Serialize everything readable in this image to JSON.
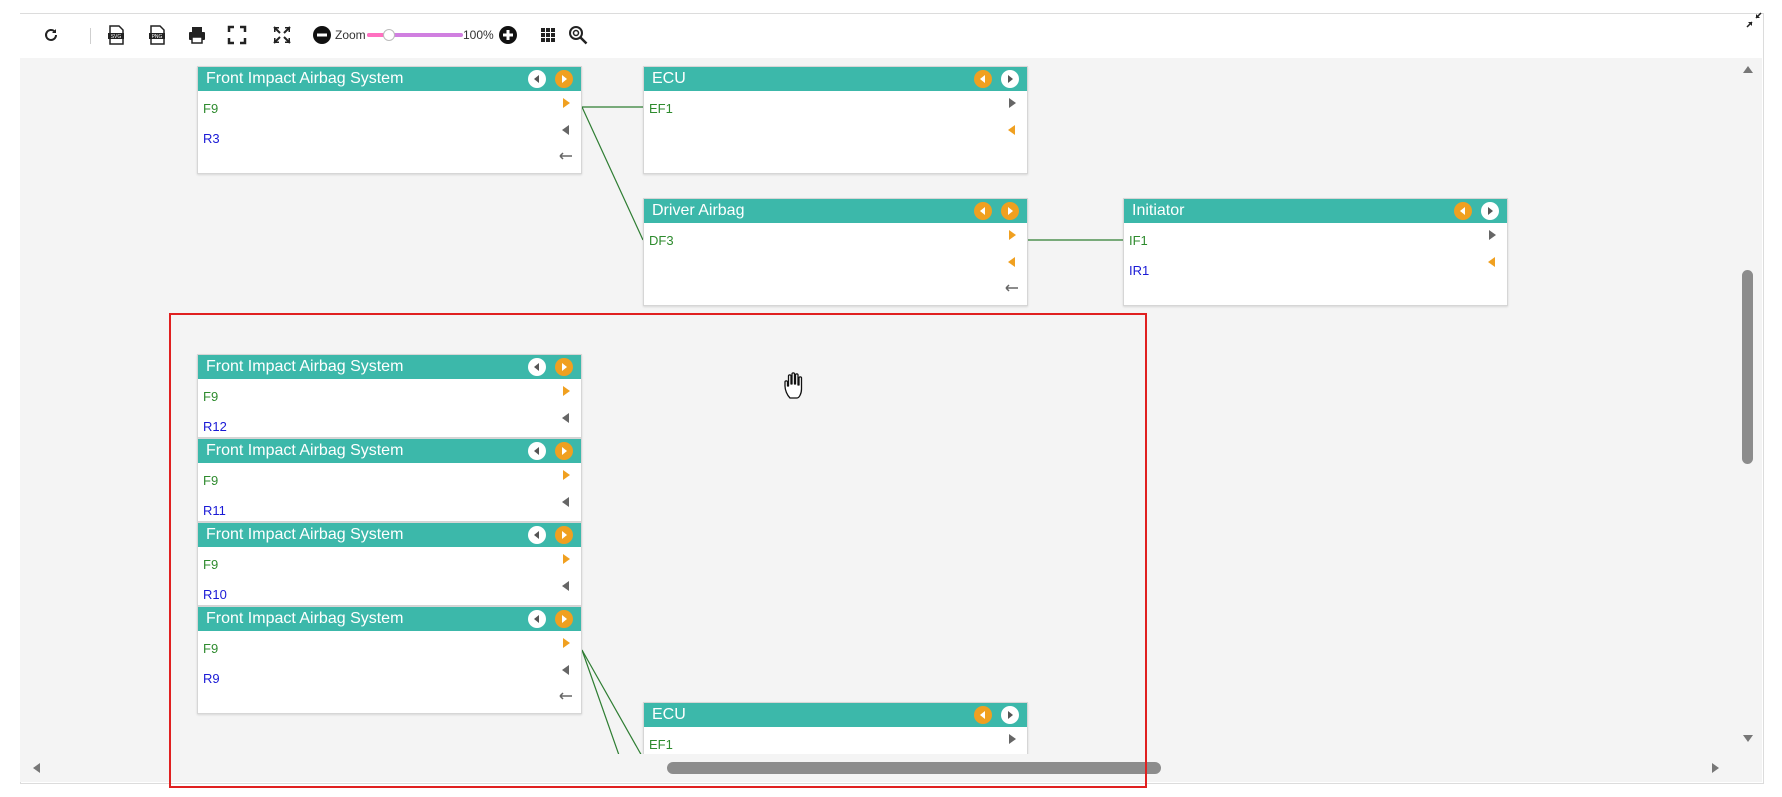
{
  "toolbar": {
    "buttons": [
      {
        "name": "refresh-icon"
      },
      {
        "name": "export-svg-icon",
        "label": "SVG"
      },
      {
        "name": "export-png-icon",
        "label": "PNG"
      },
      {
        "name": "print-icon"
      },
      {
        "name": "fullscreen-icon"
      },
      {
        "name": "fit-to-screen-icon"
      },
      {
        "name": "zoom-out-icon"
      }
    ],
    "zoom_label": "Zoom",
    "zoom_value": "100%",
    "zoom_fraction": 0.2,
    "after_zoom": [
      {
        "name": "zoom-in-icon"
      },
      {
        "name": "grid-icon"
      },
      {
        "name": "search-settings-icon"
      }
    ]
  },
  "colors": {
    "node_header": "#3cb8aa",
    "input_port_text": "#2e8b2e",
    "output_port_text": "#1a1ad6",
    "port_arrow_orange": "#f0a020",
    "port_arrow_gray": "#666666",
    "link_line": "#2e7d32",
    "selection_border": "#e02020",
    "zoom_track": "#d07fe0"
  },
  "nodes": [
    {
      "id": "n1",
      "title": "Front Impact Airbag System",
      "in_port": "F9",
      "out_port": "R3"
    },
    {
      "id": "n2",
      "title": "ECU",
      "in_port": "EF1",
      "out_port": ""
    },
    {
      "id": "n3",
      "title": "Driver Airbag",
      "in_port": "DF3",
      "out_port": ""
    },
    {
      "id": "n4",
      "title": "Initiator",
      "in_port": "IF1",
      "out_port": "IR1"
    },
    {
      "id": "n5",
      "title": "Front Impact Airbag System",
      "in_port": "F9",
      "out_port": "R12"
    },
    {
      "id": "n6",
      "title": "Front Impact Airbag System",
      "in_port": "F9",
      "out_port": "R11"
    },
    {
      "id": "n7",
      "title": "Front Impact Airbag System",
      "in_port": "F9",
      "out_port": "R10"
    },
    {
      "id": "n8",
      "title": "Front Impact Airbag System",
      "in_port": "F9",
      "out_port": "R9"
    },
    {
      "id": "n9",
      "title": "ECU",
      "in_port": "EF1",
      "out_port": ""
    }
  ],
  "scrollbars": {
    "vertical_icons": [
      "scroll-up-icon",
      "scroll-down-icon"
    ],
    "horizontal_icons": [
      "scroll-left-icon",
      "scroll-right-icon"
    ]
  },
  "window": {
    "collapse_icon": "collapse-icon"
  },
  "cursor": {
    "icon": "hand-cursor-icon"
  }
}
